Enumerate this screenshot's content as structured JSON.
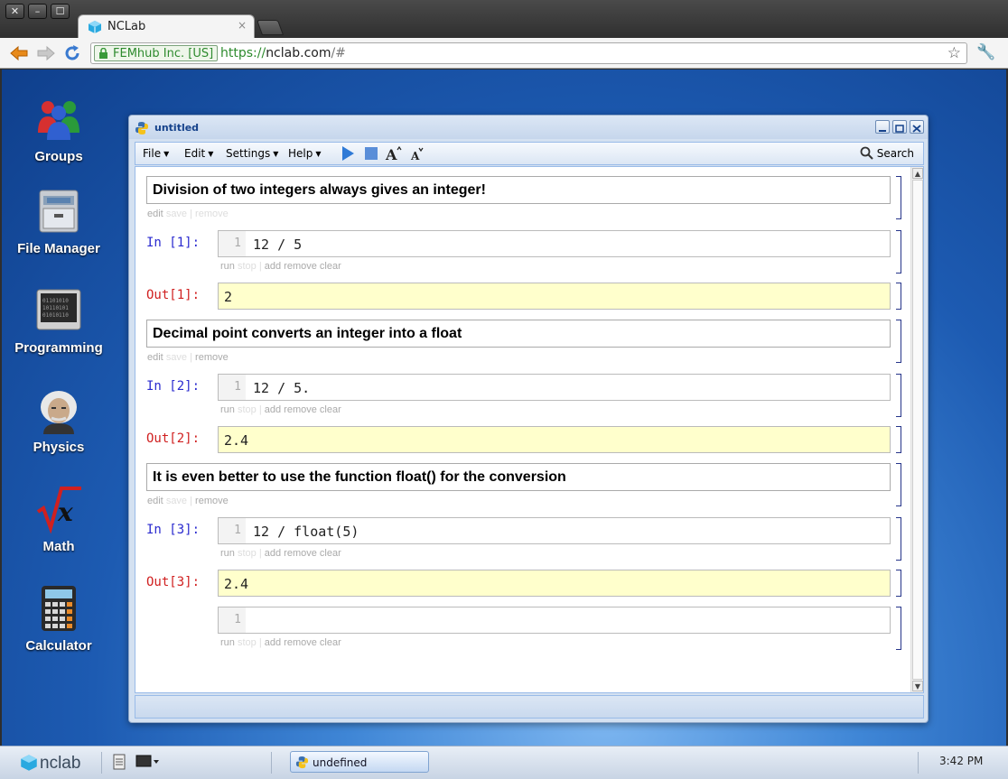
{
  "browser": {
    "window_buttons": [
      "✕",
      "–",
      "☐"
    ],
    "tab_title": "NCLab",
    "tab_close": "×",
    "ev_label": "FEMhub Inc. [US]",
    "url_scheme": "https://",
    "url_host": "nclab.com",
    "url_rest": "/#"
  },
  "desktop_icons": [
    {
      "label": "Groups"
    },
    {
      "label": "File Manager"
    },
    {
      "label": "Programming"
    },
    {
      "label": "Physics"
    },
    {
      "label": "Math"
    },
    {
      "label": "Calculator"
    }
  ],
  "app": {
    "title": "untitled",
    "menu": [
      "File",
      "Edit",
      "Settings",
      "Help"
    ],
    "search_label": "Search",
    "cells": [
      {
        "kind": "markdown",
        "text": "Division of two integers always gives an integer!",
        "actions": [
          "edit",
          "save",
          "|",
          "remove"
        ]
      },
      {
        "kind": "in",
        "prompt": "In [1]:",
        "line": "1",
        "code": "12 / 5",
        "actions": [
          "run",
          "stop",
          "|",
          "add",
          "remove",
          "clear"
        ]
      },
      {
        "kind": "out",
        "prompt": "Out[1]:",
        "value": "2"
      },
      {
        "kind": "markdown",
        "text": "Decimal point converts an integer into a float",
        "actions": [
          "edit",
          "save",
          "|",
          "remove"
        ]
      },
      {
        "kind": "in",
        "prompt": "In [2]:",
        "line": "1",
        "code": "12 / 5.",
        "actions": [
          "run",
          "stop",
          "|",
          "add",
          "remove",
          "clear"
        ]
      },
      {
        "kind": "out",
        "prompt": "Out[2]:",
        "value": "2.4"
      },
      {
        "kind": "markdown",
        "text": "It is even better to use the function float() for the conversion",
        "actions": [
          "edit",
          "save",
          "|",
          "remove"
        ]
      },
      {
        "kind": "in",
        "prompt": "In [3]:",
        "line": "1",
        "code": "12 / float(5)",
        "actions": [
          "run",
          "stop",
          "|",
          "add",
          "remove",
          "clear"
        ]
      },
      {
        "kind": "out",
        "prompt": "Out[3]:",
        "value": "2.4"
      },
      {
        "kind": "in",
        "prompt": "",
        "line": "1",
        "code": "",
        "actions": [
          "run",
          "stop",
          "|",
          "add",
          "remove",
          "clear"
        ]
      }
    ]
  },
  "taskbar": {
    "logo": "nclab",
    "task_label": "undefined",
    "clock": "3:42 PM"
  }
}
